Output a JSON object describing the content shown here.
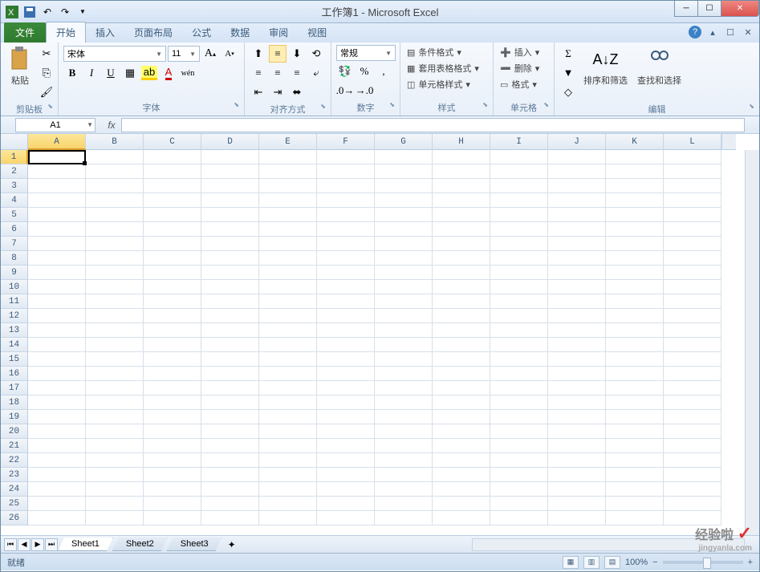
{
  "title": "工作簿1 - Microsoft Excel",
  "qat": {
    "save": "save",
    "undo": "undo",
    "redo": "redo"
  },
  "win": {
    "min": "─",
    "max": "☐",
    "close": "✕"
  },
  "tabs": {
    "file": "文件",
    "items": [
      "开始",
      "插入",
      "页面布局",
      "公式",
      "数据",
      "审阅",
      "视图"
    ],
    "active_index": 0
  },
  "ribbon_right": {
    "help": "?",
    "minimize": "▴",
    "restore": "☐",
    "close": "✕"
  },
  "clipboard": {
    "paste": "粘贴",
    "label": "剪贴板"
  },
  "font": {
    "name": "宋体",
    "size": "11",
    "bold": "B",
    "italic": "I",
    "underline": "U",
    "grow": "A",
    "shrink": "A",
    "wen": "wén",
    "label": "字体"
  },
  "alignment": {
    "label": "对齐方式"
  },
  "number": {
    "format": "常规",
    "percent": "%",
    "comma": ",",
    "label": "数字"
  },
  "styles": {
    "conditional": "条件格式",
    "table_format": "套用表格格式",
    "cell_styles": "单元格样式",
    "label": "样式"
  },
  "cells": {
    "insert": "插入",
    "delete": "删除",
    "format": "格式",
    "label": "单元格"
  },
  "editing": {
    "sigma": "Σ",
    "fill": "▾",
    "clear": "◇",
    "sort_filter": "排序和筛选",
    "find_select": "查找和选择",
    "label": "编辑"
  },
  "namebox": "A1",
  "fx": "fx",
  "columns": [
    "A",
    "B",
    "C",
    "D",
    "E",
    "F",
    "G",
    "H",
    "I",
    "J",
    "K",
    "L"
  ],
  "rows": [
    "1",
    "2",
    "3",
    "4",
    "5",
    "6",
    "7",
    "8",
    "9",
    "10",
    "11",
    "12",
    "13",
    "14",
    "15",
    "16",
    "17",
    "18",
    "19",
    "20",
    "21",
    "22",
    "23",
    "24",
    "25",
    "26"
  ],
  "sheets": {
    "nav": [
      "⏮",
      "◀",
      "▶",
      "⏭"
    ],
    "tabs": [
      "Sheet1",
      "Sheet2",
      "Sheet3"
    ],
    "active_index": 0
  },
  "status": {
    "left": "就绪",
    "zoom": "100%",
    "plus": "+",
    "minus": "−"
  },
  "watermark": {
    "brand": "经验啦",
    "check": "✓",
    "domain": "jingyanla.com"
  }
}
